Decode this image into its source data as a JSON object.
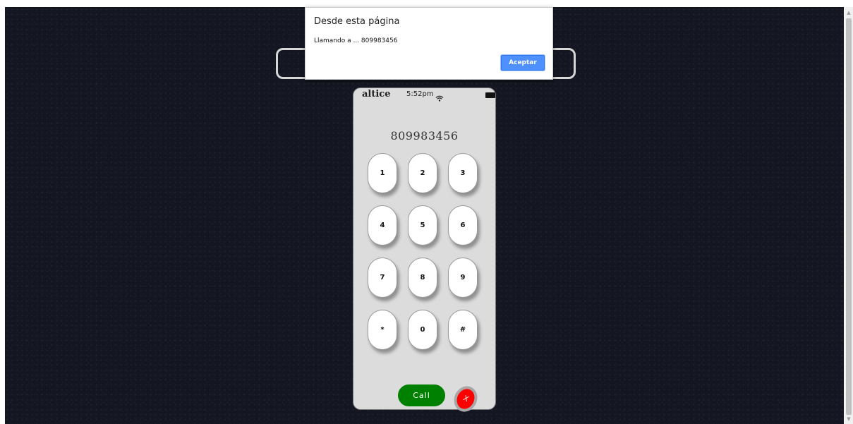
{
  "dialog": {
    "title": "Desde esta página",
    "message": "Llamando a ... 809983456",
    "ok_label": "Aceptar"
  },
  "phone": {
    "carrier": "altice",
    "time": "5:52pm",
    "display_number": "809983456",
    "keys": [
      "1",
      "2",
      "3",
      "4",
      "5",
      "6",
      "7",
      "8",
      "9",
      "*",
      "0",
      "#"
    ],
    "call_label": "Call",
    "hangup_label": "X"
  },
  "colors": {
    "background": "#141722",
    "phone_body": "#dcdcdc",
    "call_button": "#008000",
    "hangup_button": "#ff0000",
    "dialog_button": "#4d90fe"
  },
  "icons": {
    "wifi": "wifi-icon",
    "battery": "battery-icon",
    "scroll_up": "scroll-up-arrow-icon",
    "scroll_down": "scroll-down-arrow-icon"
  }
}
